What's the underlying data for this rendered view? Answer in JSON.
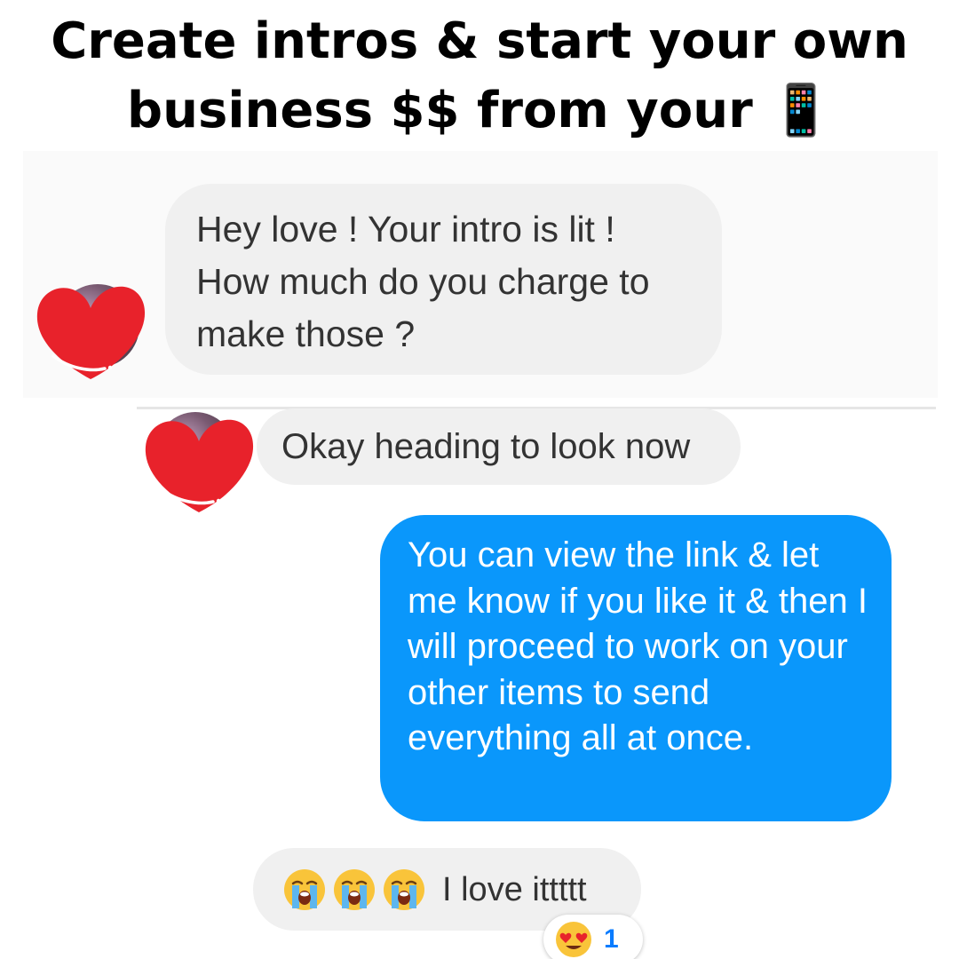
{
  "headline": {
    "line1": "Create intros & start your own",
    "line2": "business $$ from your 📱"
  },
  "messages": [
    {
      "direction": "incoming",
      "text": "Hey love ! Your intro is lit ! How much do you charge to make those ?"
    },
    {
      "direction": "incoming",
      "text": "Okay heading to look now"
    },
    {
      "direction": "outgoing",
      "text": "You can view the link & let me know if you like it & then I will proceed to work on your other items to send everything all at once."
    },
    {
      "direction": "incoming",
      "emojis": [
        "loudly-crying-face-icon",
        "loudly-crying-face-icon",
        "loudly-crying-face-icon"
      ],
      "text": "I love ittttt"
    }
  ],
  "reaction": {
    "emoji": "heart-eyes-face-icon",
    "count": "1"
  },
  "colors": {
    "outgoing_bubble": "#0a97fb",
    "incoming_bubble": "#f0f0f0",
    "heart": "#e8222b",
    "reaction_count": "#0a7cff"
  }
}
